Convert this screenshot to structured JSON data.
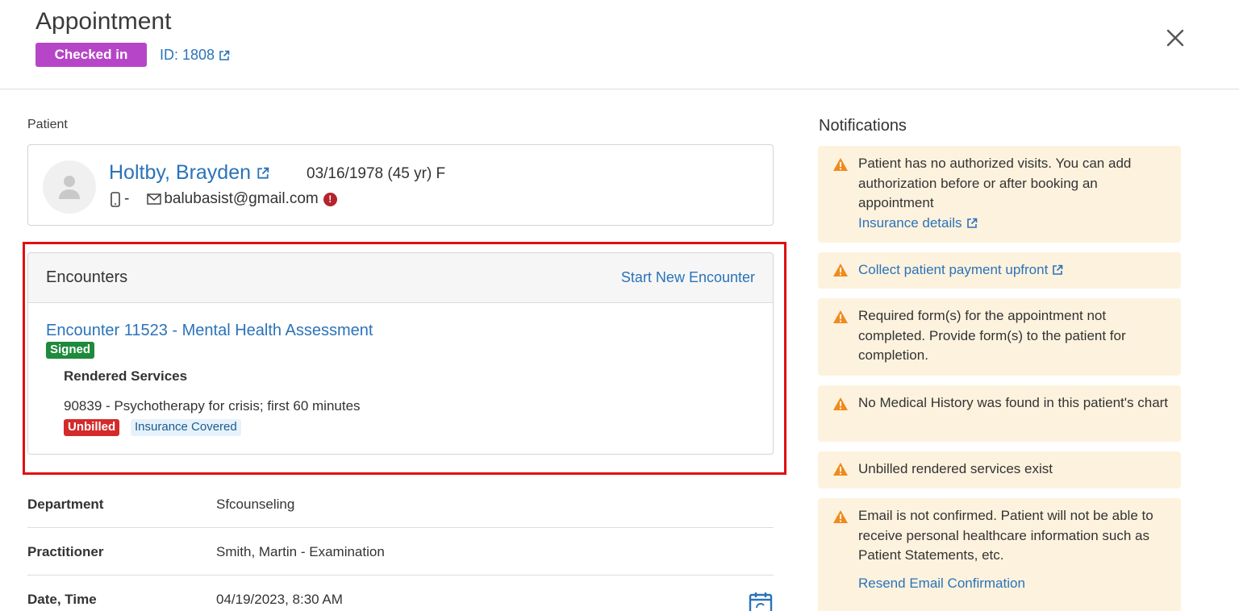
{
  "header": {
    "title": "Appointment",
    "status": "Checked in",
    "id_label": "ID: 1808"
  },
  "patient": {
    "section_label": "Patient",
    "name": "Holtby, Brayden",
    "dob": "03/16/1978 (45 yr) F",
    "phone": "-",
    "email": "balubasist@gmail.com",
    "email_error": "!"
  },
  "encounters": {
    "title": "Encounters",
    "start_new": "Start New Encounter",
    "items": [
      {
        "label": "Encounter 11523 - Mental Health Assessment",
        "status": "Signed",
        "rendered_title": "Rendered Services",
        "services": [
          {
            "description": "90839 - Psychotherapy for crisis; first 60 minutes",
            "billing_status": "Unbilled",
            "coverage": "Insurance Covered"
          }
        ]
      }
    ]
  },
  "details": [
    {
      "label": "Department",
      "value": "Sfcounseling"
    },
    {
      "label": "Practitioner",
      "value": "Smith, Martin - Examination"
    },
    {
      "label": "Date, Time",
      "value": "04/19/2023, 8:30 AM"
    }
  ],
  "notifications": {
    "title": "Notifications",
    "items": [
      {
        "text": "Patient has no authorized visits. You can add authorization before or after booking an appointment",
        "link": "Insurance details"
      },
      {
        "text": "",
        "link": "Collect patient payment upfront"
      },
      {
        "text": "Required form(s) for the appointment not completed. Provide form(s) to the patient for completion.",
        "link": ""
      },
      {
        "text": "No Medical History was found in this patient's chart",
        "link": ""
      },
      {
        "text": "Unbilled rendered services exist",
        "link": ""
      },
      {
        "text": "Email is not confirmed. Patient will not be able to receive personal healthcare information such as Patient Statements, etc.",
        "link": "Resend Email Confirmation"
      }
    ]
  },
  "colors": {
    "status_checked_in": "#b646c7",
    "link": "#2a73b9",
    "signed": "#1e8a3c",
    "unbilled": "#d42a2a",
    "warning_bg": "#fdf2de",
    "warning_icon": "#f08a1c",
    "highlight": "#e01010"
  }
}
